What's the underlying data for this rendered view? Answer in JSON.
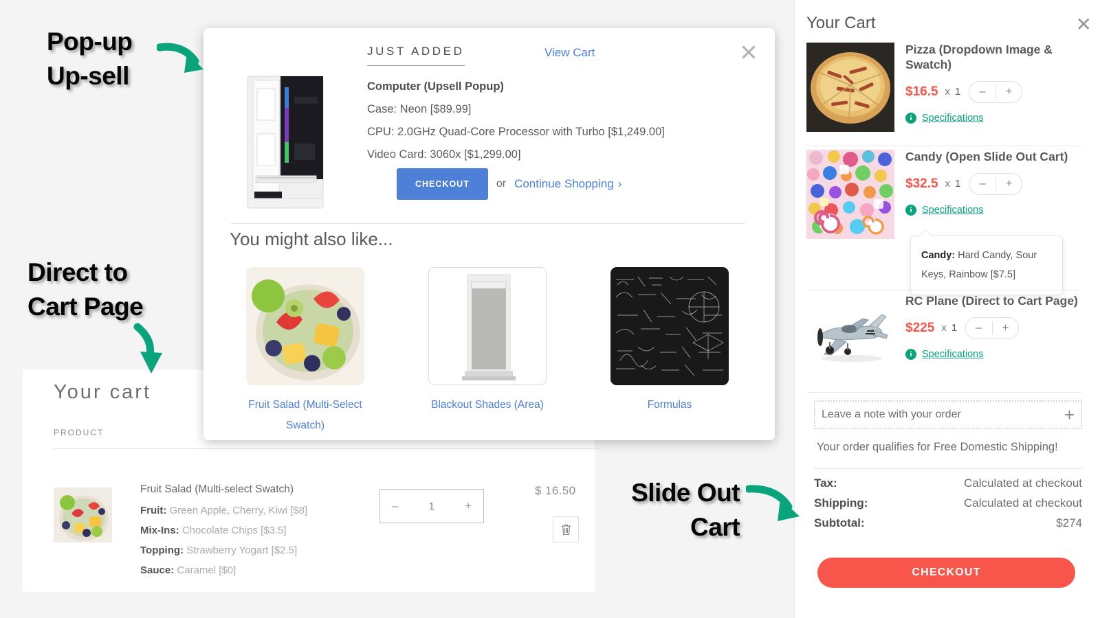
{
  "annotations": {
    "popup_label": "Pop-up\nUp-sell",
    "cart_page_label": "Direct to\nCart Page",
    "slide_out_label": "Slide Out\nCart"
  },
  "popup": {
    "header": "JUST ADDED",
    "view_cart": "View Cart",
    "close_icon": "close-icon",
    "product_title": "Computer (Upsell Popup)",
    "options": [
      "Case: Neon [$89.99]",
      "CPU: 2.0GHz Quad-Core Processor with Turbo [$1,249.00]",
      "Video Card: 3060x [$1,299.00]"
    ],
    "checkout_label": "CHECKOUT",
    "or_label": "or",
    "continue_label": "Continue Shopping",
    "continue_chevron": "›",
    "recommend_title": "You might also like...",
    "recommendations": [
      {
        "label": "Fruit Salad (Multi-Select Swatch)",
        "image": "fruit-salad-image"
      },
      {
        "label": "Blackout Shades (Area)",
        "image": "blackout-shades-image"
      },
      {
        "label": "Formulas",
        "image": "formulas-image"
      }
    ]
  },
  "cart_page": {
    "title": "Your cart",
    "column_header": "PRODUCT",
    "item": {
      "name": "Fruit Salad (Multi-select Swatch)",
      "options": [
        {
          "label": "Fruit:",
          "value": "Green Apple, Cherry, Kiwi [$8]"
        },
        {
          "label": "Mix-Ins:",
          "value": "Chocolate Chips [$3.5]"
        },
        {
          "label": "Topping:",
          "value": "Strawberry Yogart [$2.5]"
        },
        {
          "label": "Sauce:",
          "value": "Caramel [$0]"
        }
      ],
      "quantity": "1",
      "minus": "–",
      "plus": "+",
      "price": "$ 16.50",
      "remove_icon": "trash-icon"
    }
  },
  "slideout": {
    "title": "Your Cart",
    "close_icon": "close-icon",
    "items": [
      {
        "name": "Pizza (Dropdown Image & Swatch)",
        "price": "$16.5",
        "x": "x",
        "qty": "1",
        "specs_label": "Specifications",
        "image": "pizza-image"
      },
      {
        "name": "Candy (Open Slide Out Cart)",
        "price": "$32.5",
        "x": "x",
        "qty": "1",
        "specs_label": "Specifications",
        "image": "candy-image"
      },
      {
        "name": "RC Plane (Direct to Cart Page)",
        "price": "$225",
        "x": "x",
        "qty": "1",
        "specs_label": "Specifications",
        "image": "rc-plane-image"
      }
    ],
    "tooltip": {
      "label": "Candy:",
      "value": " Hard Candy, Sour Keys, Rainbow [$7.5]"
    },
    "note_placeholder": "Leave a note with your order",
    "note_plus": "+",
    "free_shipping": "Your order qualifies for Free Domestic Shipping!",
    "totals": [
      {
        "label": "Tax:",
        "value": "Calculated at checkout"
      },
      {
        "label": "Shipping:",
        "value": "Calculated at checkout"
      },
      {
        "label": "Subtotal:",
        "value": "$274"
      }
    ],
    "checkout_label": "CHECKOUT",
    "stepper_minus": "–",
    "stepper_plus": "+"
  },
  "colors": {
    "accent_blue": "#4e80d8",
    "link_blue": "#4b7fe0",
    "price_red": "#f8564a",
    "specs_green": "#0aa47c",
    "arrow_teal": "#0aa47c",
    "page_bg": "#f4f4f4"
  }
}
